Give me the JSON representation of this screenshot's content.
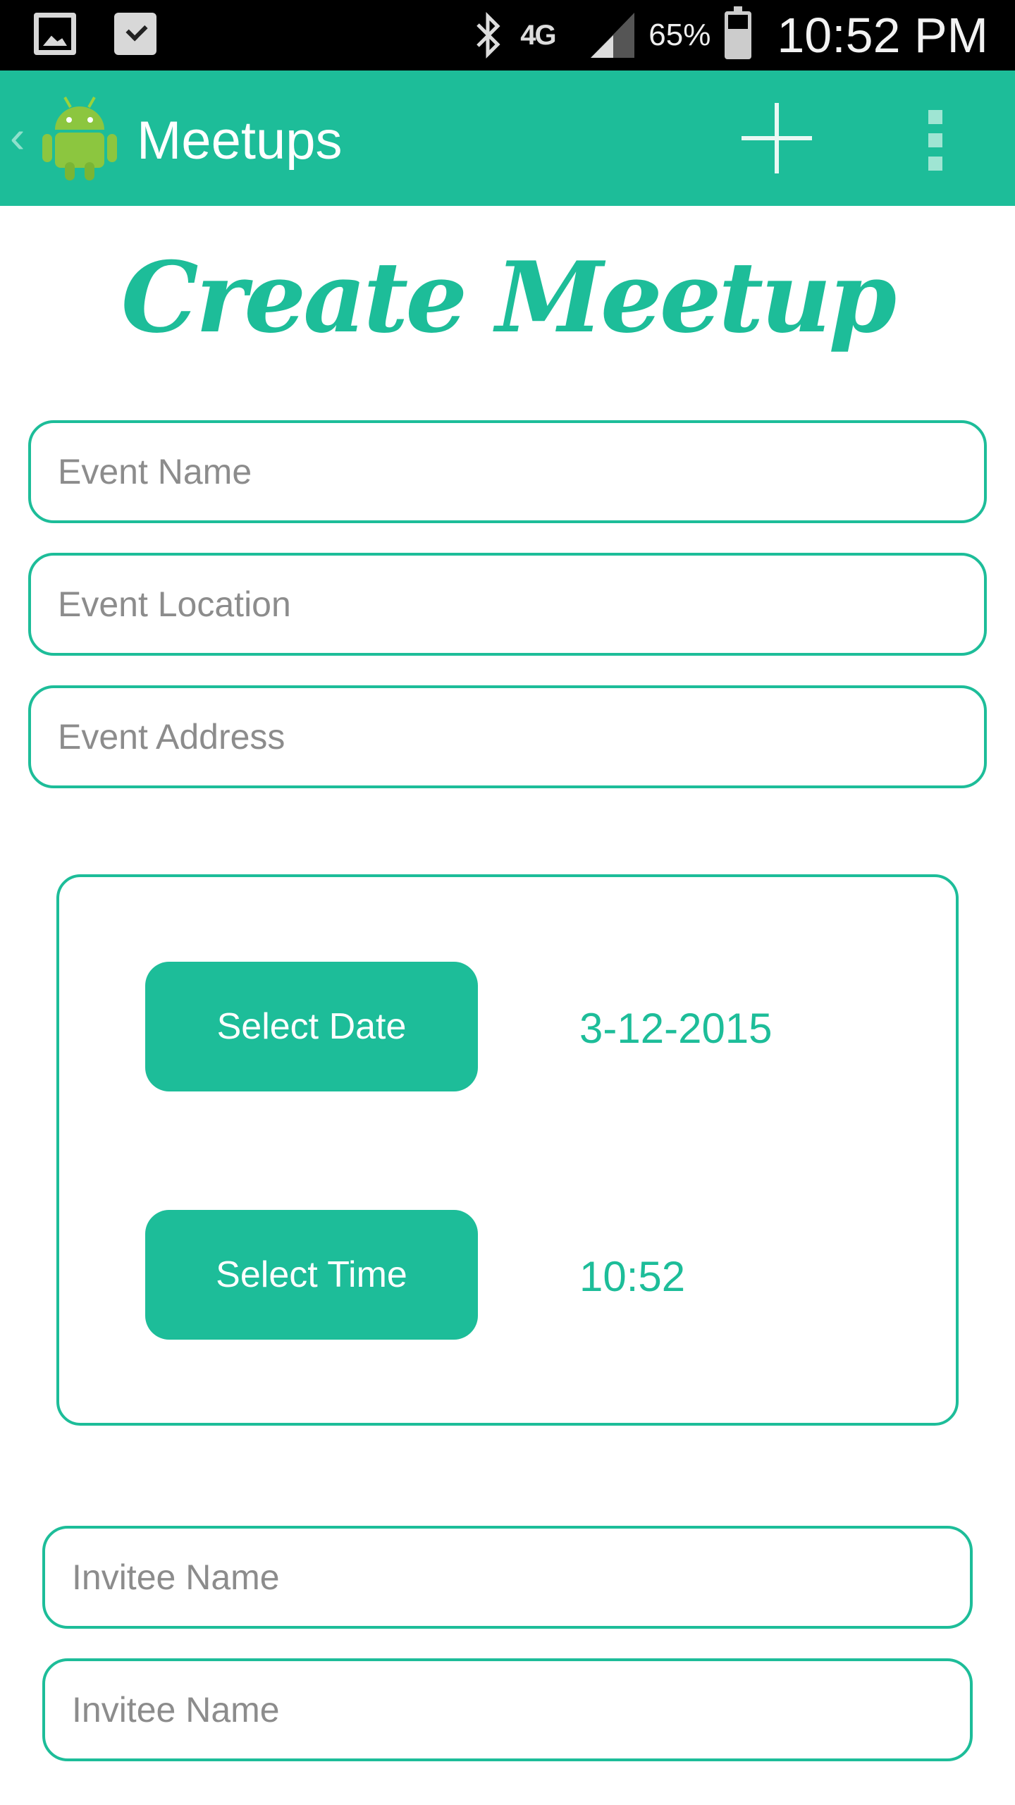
{
  "status_bar": {
    "network": "4G",
    "battery_percent": "65%",
    "time": "10:52 PM",
    "icons": [
      "gallery-icon",
      "tasks-icon",
      "bluetooth-icon",
      "lte-icon",
      "signal-icon",
      "battery-icon"
    ]
  },
  "action_bar": {
    "title": "Meetups",
    "icons": [
      "back-icon",
      "android-logo-icon",
      "add-icon",
      "overflow-menu-icon"
    ],
    "color": "#1dbd99"
  },
  "heading": "Create Meetup",
  "form": {
    "event_name": {
      "value": "",
      "placeholder": "Event Name"
    },
    "event_location": {
      "value": "",
      "placeholder": "Event Location"
    },
    "event_address": {
      "value": "",
      "placeholder": "Event Address"
    },
    "select_date_label": "Select Date",
    "selected_date": "3-12-2015",
    "select_time_label": "Select Time",
    "selected_time": "10:52",
    "invitees": [
      {
        "value": "",
        "placeholder": "Invitee Name"
      },
      {
        "value": "",
        "placeholder": "Invitee Name"
      }
    ]
  },
  "colors": {
    "accent": "#1dbd99",
    "placeholder": "#8c8c8c"
  }
}
